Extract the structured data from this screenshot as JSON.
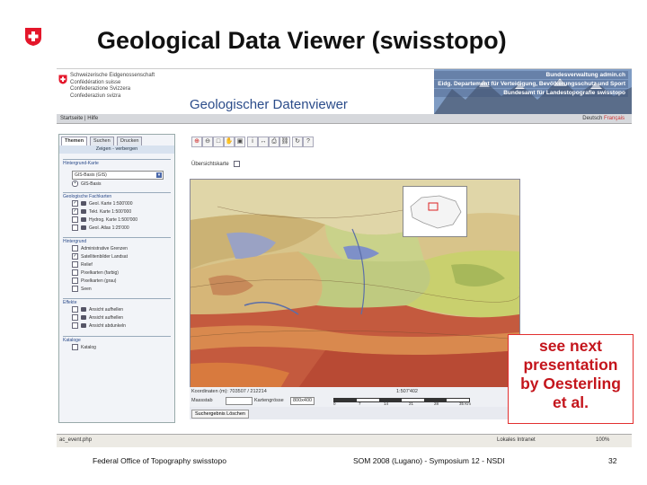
{
  "slide": {
    "title": "Geological Data Viewer (swisstopo)",
    "logo_icon": "swiss-cross-icon",
    "accent_red": "#e4162a"
  },
  "banner": {
    "admin_lines": [
      "Schweizerische Eidgenossenschaft",
      "Confédération suisse",
      "Confederazione Svizzera",
      "Confederaziun svizra"
    ],
    "dept_lines": [
      "Bundesverwaltung admin.ch",
      "Eidg. Departement für Verteidigung, Bevölkerungsschutz und Sport",
      "Bundesamt für Landestopografie swisstopo"
    ],
    "app_title": "Geologischer Datenviewer"
  },
  "menubar": {
    "left": "Startseite | Hilfe",
    "lang_active": "Deutsch",
    "lang_other": "Français"
  },
  "panel": {
    "tabs": [
      "Themen",
      "Suchen",
      "Drucken"
    ],
    "group_title": "Zeigen - verbergen",
    "basemap_header": "Hintergrund-Karte",
    "basemap_selected": "GIS-Basis (GIS)",
    "basemap_radio": "GIS-Basis",
    "geo_header": "Geologische Fachkarten",
    "geo_items": [
      "Geol. Karte 1:500'000",
      "Tekt. Karte 1:500'000",
      "Hydrog. Karte 1:500'000",
      "Geol. Atlas 1:25'000"
    ],
    "bg_header": "Hintergrund",
    "bg_items": [
      "Administrative Grenzen",
      "Satellitenbilder Landsat",
      "Relief",
      "Pixelkarten (farbig)",
      "Pixelkarten (grau)",
      "Seen"
    ],
    "fx_header": "Effekte",
    "fx_items": [
      "Ansicht aufhellen",
      "Ansicht aufhellen",
      "Ansicht abdunkeln"
    ],
    "cat_header": "Kataloge",
    "cat_item": "Katalog"
  },
  "map": {
    "overview_label": "Übersichtskarte",
    "coords_label": "Koordinaten (m): 703507 / 212214",
    "scale_value": "1:507'402",
    "scale_ticks": [
      "0",
      "7",
      "14",
      "21",
      "28",
      "35 Km"
    ],
    "massstab_label": "Massstab",
    "kartengroesse_label": "Kartengrösse",
    "kartengroesse_value": "800x400",
    "clear_button": "Suchergebnis Löschen"
  },
  "iebar": {
    "left": "ac_event.php",
    "zone": "Lokales Intranet",
    "zoom": "100%"
  },
  "callout": {
    "lines": [
      "see next",
      "presentation",
      "by Oesterling",
      "et al."
    ]
  },
  "footer": {
    "left": "Federal Office of Topography swisstopo",
    "center": "SOM 2008 (Lugano) - Symposium 12 - NSDI",
    "page": "32"
  }
}
